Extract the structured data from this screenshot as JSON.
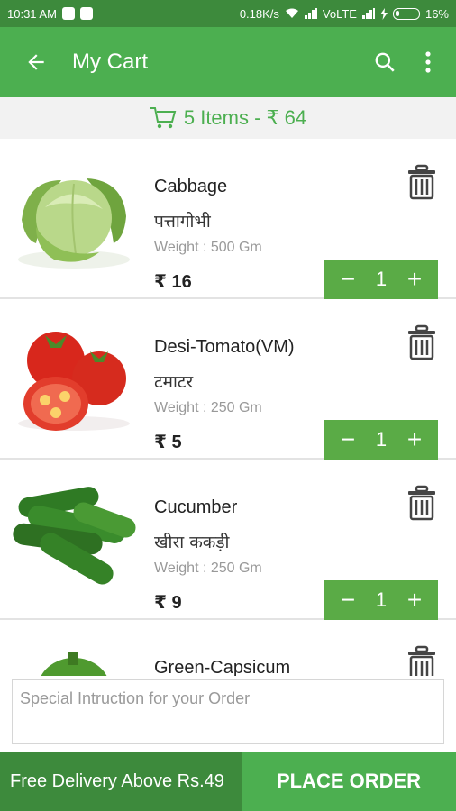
{
  "status_bar": {
    "time": "10:31 AM",
    "network_speed": "0.18K/s",
    "carrier": "VoLTE",
    "battery": "16%"
  },
  "app_bar": {
    "title": "My Cart",
    "back_icon": "arrow-left-icon",
    "search_icon": "search-icon",
    "menu_icon": "more-vertical-icon"
  },
  "summary": {
    "text": "5 Items - ₹ 64",
    "icon": "cart-icon"
  },
  "items": [
    {
      "name": "Cabbage",
      "hindi": "पत्तागोभी",
      "weight": "Weight : 500 Gm",
      "price": "₹ 16",
      "qty": "1",
      "image": "cabbage"
    },
    {
      "name": "Desi-Tomato(VM)",
      "hindi": "टमाटर",
      "weight": "Weight : 250 Gm",
      "price": "₹ 5",
      "qty": "1",
      "image": "tomato"
    },
    {
      "name": "Cucumber",
      "hindi": "खीरा ककड़ी",
      "weight": "Weight : 250 Gm",
      "price": "₹ 9",
      "qty": "1",
      "image": "cucumber"
    },
    {
      "name": "Green-Capsicum",
      "hindi": "",
      "weight": "",
      "price": "",
      "qty": "",
      "image": "capsicum"
    }
  ],
  "stepper": {
    "minus": "−",
    "plus": "+"
  },
  "instructions": {
    "placeholder": "Special Intruction for your Order",
    "value": ""
  },
  "footer": {
    "free_delivery": "Free Delivery Above Rs.49",
    "place_order": "PLACE ORDER"
  },
  "colors": {
    "status_bar": "#3d8a3c",
    "app_bar": "#4caf50",
    "stepper": "#5aab46",
    "footer_left": "#3d8a3c",
    "footer_right": "#4caf50"
  }
}
